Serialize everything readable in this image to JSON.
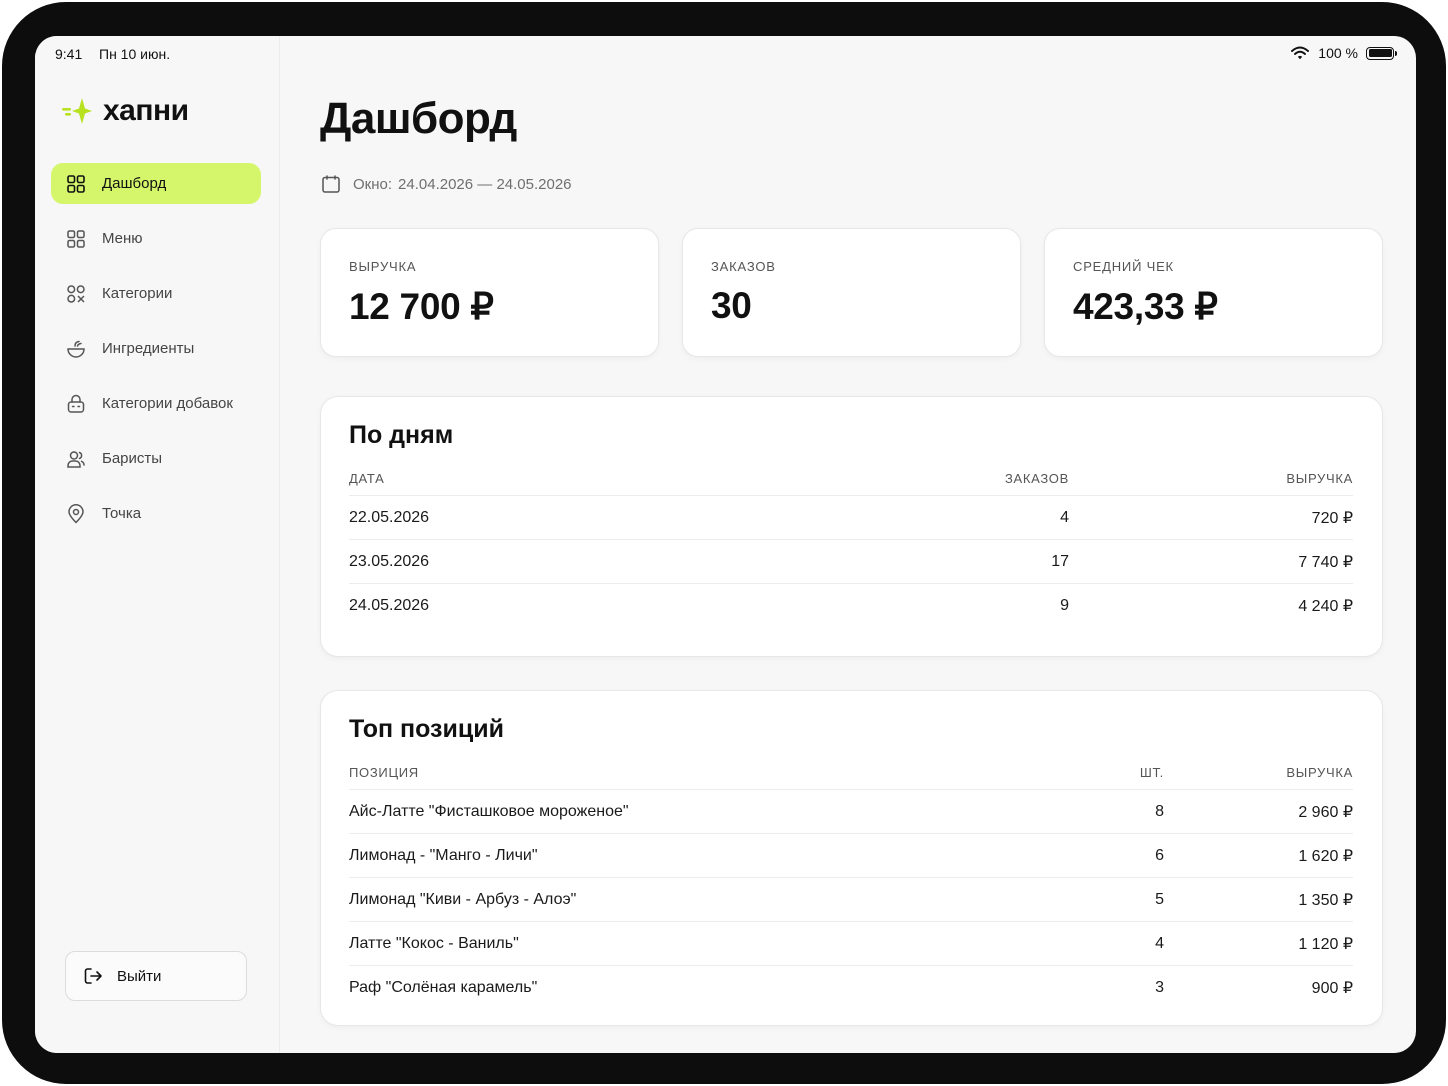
{
  "status_bar": {
    "time": "9:41",
    "date": "Пн 10 июн.",
    "battery": "100 %"
  },
  "brand": {
    "name": "хапни",
    "accent_color": "#d5f56a"
  },
  "sidebar": {
    "items": [
      {
        "label": "Дашборд",
        "icon": "dashboard-grid-icon",
        "active": true
      },
      {
        "label": "Меню",
        "icon": "menu-grid-icon",
        "active": false
      },
      {
        "label": "Категории",
        "icon": "categories-icon",
        "active": false
      },
      {
        "label": "Ингредиенты",
        "icon": "bowl-icon",
        "active": false
      },
      {
        "label": "Категории добавок",
        "icon": "addon-box-icon",
        "active": false
      },
      {
        "label": "Баристы",
        "icon": "users-icon",
        "active": false
      },
      {
        "label": "Точка",
        "icon": "location-pin-icon",
        "active": false
      }
    ],
    "logout_label": "Выйти"
  },
  "page": {
    "title": "Дашборд",
    "period_label": "Окно:",
    "period_value": "24.04.2026 — 24.05.2026"
  },
  "kpis": [
    {
      "label": "ВЫРУЧКА",
      "value": "12 700 ₽"
    },
    {
      "label": "ЗАКАЗОВ",
      "value": "30"
    },
    {
      "label": "СРЕДНИЙ ЧЕК",
      "value": "423,33 ₽"
    }
  ],
  "by_day": {
    "title": "По дням",
    "columns": [
      "ДАТА",
      "ЗАКАЗОВ",
      "ВЫРУЧКА"
    ],
    "rows": [
      {
        "date": "22.05.2026",
        "orders": "4",
        "revenue": "720 ₽"
      },
      {
        "date": "23.05.2026",
        "orders": "17",
        "revenue": "7 740 ₽"
      },
      {
        "date": "24.05.2026",
        "orders": "9",
        "revenue": "4 240 ₽"
      }
    ]
  },
  "top_items": {
    "title": "Топ позиций",
    "columns": [
      "ПОЗИЦИЯ",
      "ШТ.",
      "ВЫРУЧКА"
    ],
    "rows": [
      {
        "name": "Айс-Латте \"Фисташковое мороженое\"",
        "qty": "8",
        "revenue": "2 960 ₽"
      },
      {
        "name": "Лимонад - \"Манго - Личи\"",
        "qty": "6",
        "revenue": "1 620 ₽"
      },
      {
        "name": "Лимонад \"Киви - Арбуз - Алоэ\"",
        "qty": "5",
        "revenue": "1 350 ₽"
      },
      {
        "name": "Латте \"Кокос - Ваниль\"",
        "qty": "4",
        "revenue": "1 120 ₽"
      },
      {
        "name": "Раф \"Солёная карамель\"",
        "qty": "3",
        "revenue": "900 ₽"
      }
    ]
  }
}
